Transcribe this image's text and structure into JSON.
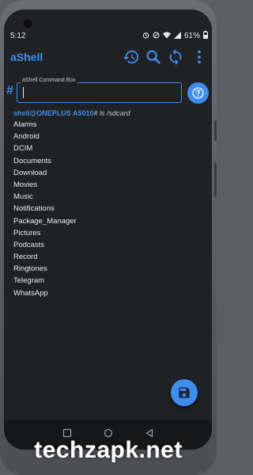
{
  "status_bar": {
    "time": "5:12",
    "battery": "61%"
  },
  "app": {
    "title": "aShell"
  },
  "command_box": {
    "label": "aShell Command Box",
    "prompt_symbol": "#",
    "value": ""
  },
  "output": {
    "prompt_user": "shell@ONEPLUS A5010",
    "prompt_cmd": "# ls /sdcard",
    "lines": [
      "Alarms",
      "Android",
      "DCIM",
      "Documents",
      "Download",
      "Movies",
      "Music",
      "Notifications",
      "Package_Manager",
      "Pictures",
      "Podcasts",
      "Record",
      "Ringtones",
      "Telegram",
      "WhatsApp"
    ]
  },
  "watermark": "techzapk.net",
  "colors": {
    "accent": "#3d8ef0",
    "background": "#202124"
  }
}
